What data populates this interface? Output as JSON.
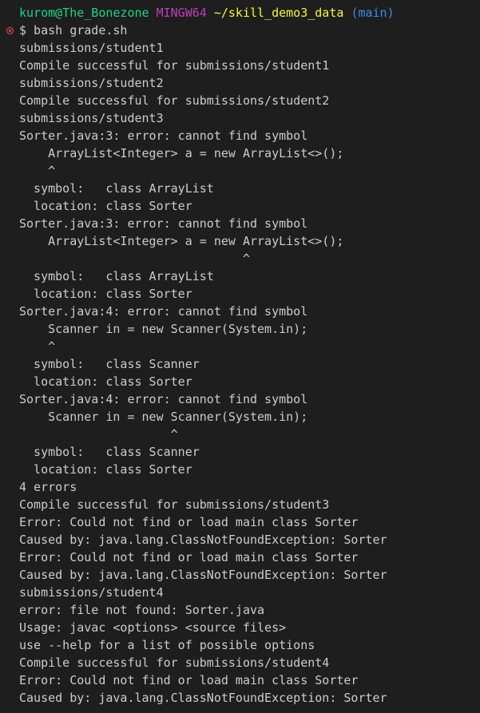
{
  "prompt": {
    "user": "kurom@The_Bonezone",
    "env": "MINGW64",
    "path": "~/skill_demo3_data",
    "branch": "(main)"
  },
  "colors": {
    "background": "#1e1e1e",
    "text": "#cccccc",
    "user": "#23d18b",
    "env": "#bc3fbc",
    "path": "#f5f543",
    "branch": "#3b8eea",
    "error_decoration": "#f14c4c"
  },
  "command": "$ bash grade.sh",
  "output": [
    "submissions/student1",
    "Compile successful for submissions/student1",
    "submissions/student2",
    "Compile successful for submissions/student2",
    "submissions/student3",
    "Sorter.java:3: error: cannot find symbol",
    "    ArrayList<Integer> a = new ArrayList<>();",
    "    ^",
    "  symbol:   class ArrayList",
    "  location: class Sorter",
    "Sorter.java:3: error: cannot find symbol",
    "    ArrayList<Integer> a = new ArrayList<>();",
    "                               ^",
    "  symbol:   class ArrayList",
    "  location: class Sorter",
    "Sorter.java:4: error: cannot find symbol",
    "    Scanner in = new Scanner(System.in);",
    "    ^",
    "  symbol:   class Scanner",
    "  location: class Sorter",
    "Sorter.java:4: error: cannot find symbol",
    "    Scanner in = new Scanner(System.in);",
    "                     ^",
    "  symbol:   class Scanner",
    "  location: class Sorter",
    "4 errors",
    "Compile successful for submissions/student3",
    "Error: Could not find or load main class Sorter",
    "Caused by: java.lang.ClassNotFoundException: Sorter",
    "Error: Could not find or load main class Sorter",
    "Caused by: java.lang.ClassNotFoundException: Sorter",
    "submissions/student4",
    "error: file not found: Sorter.java",
    "Usage: javac <options> <source files>",
    "use --help for a list of possible options",
    "Compile successful for submissions/student4",
    "Error: Could not find or load main class Sorter",
    "Caused by: java.lang.ClassNotFoundException: Sorter"
  ]
}
